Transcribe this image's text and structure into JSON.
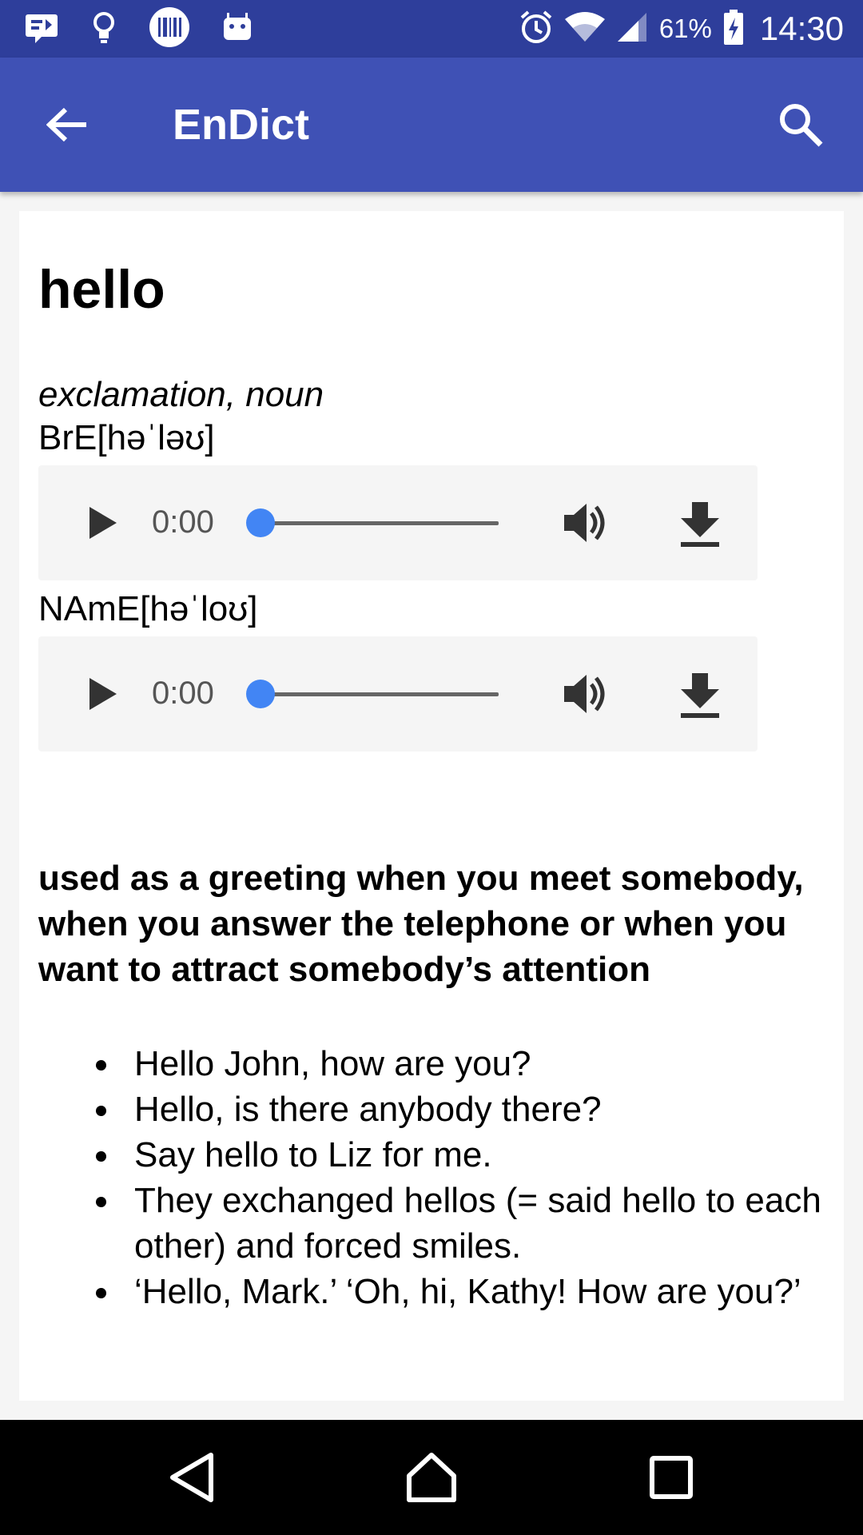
{
  "status_bar": {
    "battery_percent": "61%",
    "time": "14:30",
    "icons": [
      "notification-icon",
      "lightbulb-icon",
      "barcode-icon",
      "android-icon",
      "alarm-icon",
      "wifi-icon",
      "signal-icon",
      "battery-charging-icon"
    ]
  },
  "app_bar": {
    "title": "EnDict",
    "back_icon": "arrow-left-icon",
    "search_icon": "search-icon"
  },
  "entry": {
    "headword": "hello",
    "part_of_speech": "exclamation, noun",
    "pronunciations": [
      {
        "label": "BrE[həˈləʊ]",
        "time": "0:00",
        "progress": 0
      },
      {
        "label": "NAmE[həˈloʊ]",
        "time": "0:00",
        "progress": 0
      }
    ],
    "definition": "used as a greeting when you meet somebody, when you answer the telephone or when you want to attract somebody’s attention",
    "examples": [
      " Hello John, how are you?",
      " Hello, is there anybody there?",
      " Say hello to Liz for me.",
      " They exchanged hellos (= said hello to each other) and forced smiles.",
      " ‘Hello, Mark.’ ‘Oh, hi, Kathy! How are you?’"
    ]
  },
  "colors": {
    "status_bar": "#2e3e9b",
    "app_bar": "#3f51b5",
    "accent": "#4285f4",
    "nav_bar": "#000000"
  },
  "nav": [
    "back-triangle-icon",
    "home-icon",
    "recents-square-icon"
  ]
}
